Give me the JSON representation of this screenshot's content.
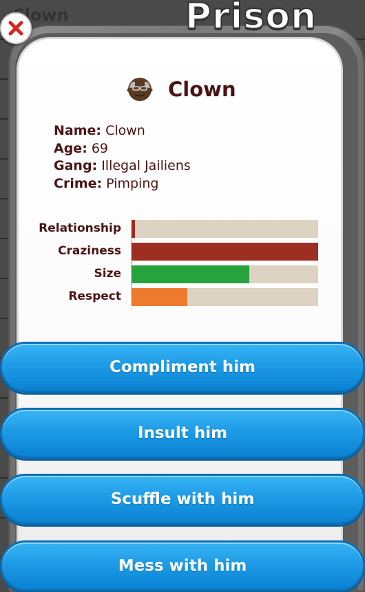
{
  "background": {
    "title": "Clown"
  },
  "window": {
    "title": "Prison"
  },
  "close_icon": "close-x-icon",
  "prisoner": {
    "name_title": "Clown",
    "fields": [
      {
        "label": "Name:",
        "value": "Clown"
      },
      {
        "label": "Age:",
        "value": "69"
      },
      {
        "label": "Gang:",
        "value": "Illegal Jailiens"
      },
      {
        "label": "Crime:",
        "value": "Pimping"
      }
    ]
  },
  "stats": [
    {
      "label": "Relationship",
      "value": 0.02,
      "color": "#a12a1f"
    },
    {
      "label": "Craziness",
      "value": 1.0,
      "color": "#9c2e22"
    },
    {
      "label": "Size",
      "value": 0.63,
      "color": "#26a33c"
    },
    {
      "label": "Respect",
      "value": 0.3,
      "color": "#ee7a2e"
    }
  ],
  "stat_bar_bg": "#dcd3c2",
  "actions": [
    {
      "label": "Compliment him"
    },
    {
      "label": "Insult him"
    },
    {
      "label": "Scuffle with him"
    },
    {
      "label": "Mess with him"
    }
  ],
  "colors": {
    "button_blue": "#1e9be6",
    "text_dark_red": "#4a1414",
    "close_red": "#d7261e"
  }
}
